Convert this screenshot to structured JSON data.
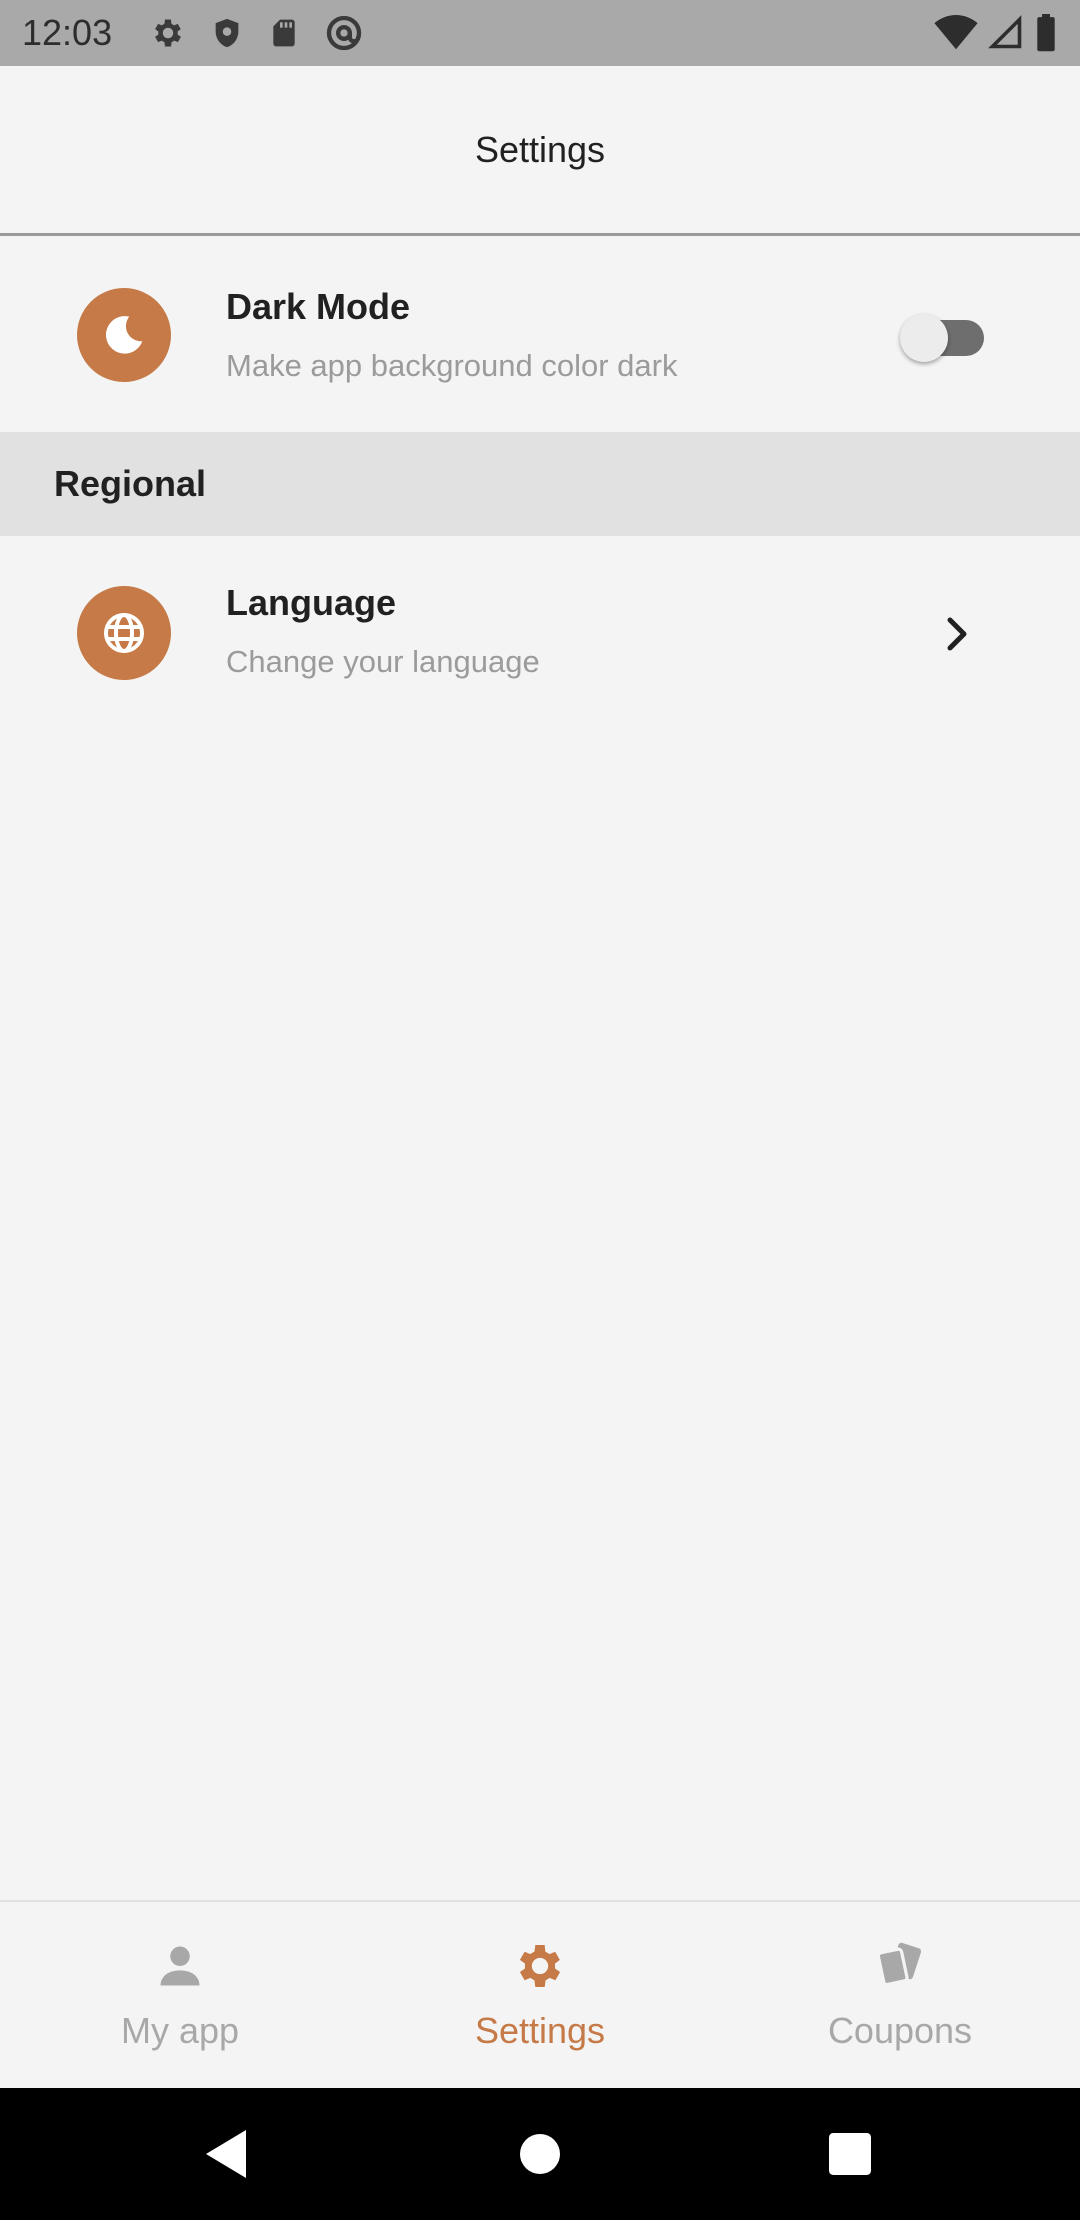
{
  "status_bar": {
    "time": "12:03",
    "left_icons": [
      "gear-icon",
      "shield-icon",
      "sd-card-icon",
      "at-sign-icon"
    ],
    "right_icons": [
      "wifi-icon",
      "signal-icon",
      "battery-icon"
    ]
  },
  "app_bar": {
    "title": "Settings"
  },
  "settings": {
    "dark_mode": {
      "icon": "moon-icon",
      "title": "Dark Mode",
      "subtitle": "Make app background color dark",
      "enabled": false
    },
    "regional_section": {
      "label": "Regional"
    },
    "language": {
      "icon": "globe-icon",
      "title": "Language",
      "subtitle": "Change your language"
    }
  },
  "bottom_nav": {
    "items": [
      {
        "label": "My app",
        "icon": "person-icon",
        "active": false
      },
      {
        "label": "Settings",
        "icon": "gear-icon",
        "active": true
      },
      {
        "label": "Coupons",
        "icon": "cards-icon",
        "active": false
      }
    ]
  },
  "colors": {
    "accent": "#c57a47",
    "background": "#f4f4f4",
    "section_background": "#e1e1e1",
    "status_bar": "#a9a9a9",
    "inactive_nav": "#a8a8a8",
    "secondary_text": "#9b9b9b"
  }
}
